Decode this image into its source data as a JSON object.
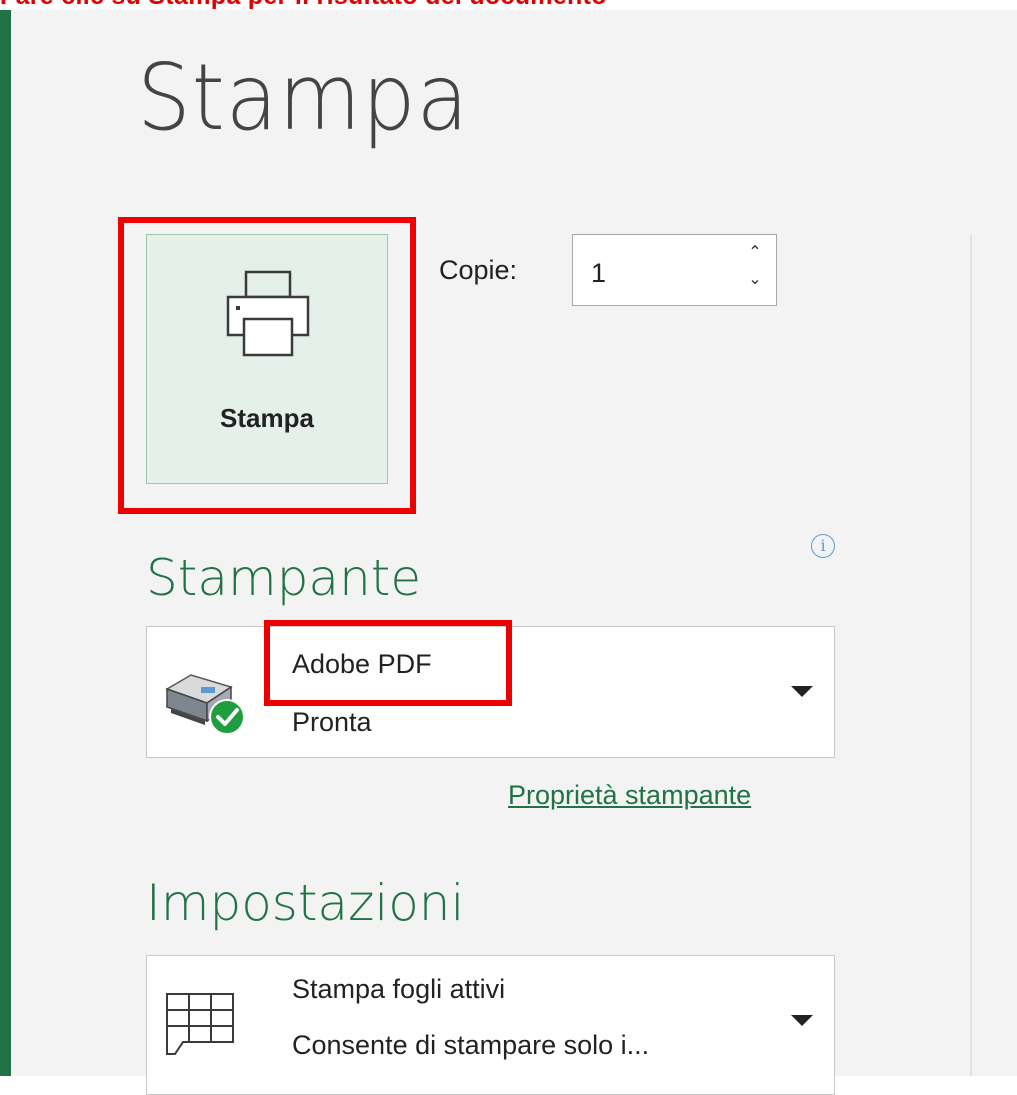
{
  "banner_text": "Fare clic su Stampa per il risultato del documento",
  "page_title": "Stampa",
  "print_button": {
    "label": "Stampa",
    "icon": "printer-icon"
  },
  "copies": {
    "label": "Copie:",
    "value": "1",
    "up": "⌃",
    "down": "⌄"
  },
  "printer": {
    "section_title": "Stampante",
    "info_icon": "i",
    "name": "Adobe PDF",
    "status": "Pronta",
    "properties_link": "Proprietà stampante"
  },
  "settings": {
    "section_title": "Impostazioni",
    "option_title": "Stampa fogli attivi",
    "option_desc": "Consente di stampare solo i..."
  },
  "colors": {
    "accent": "#217346",
    "annotation": "#ee0000",
    "info": "#5b9bd5"
  }
}
